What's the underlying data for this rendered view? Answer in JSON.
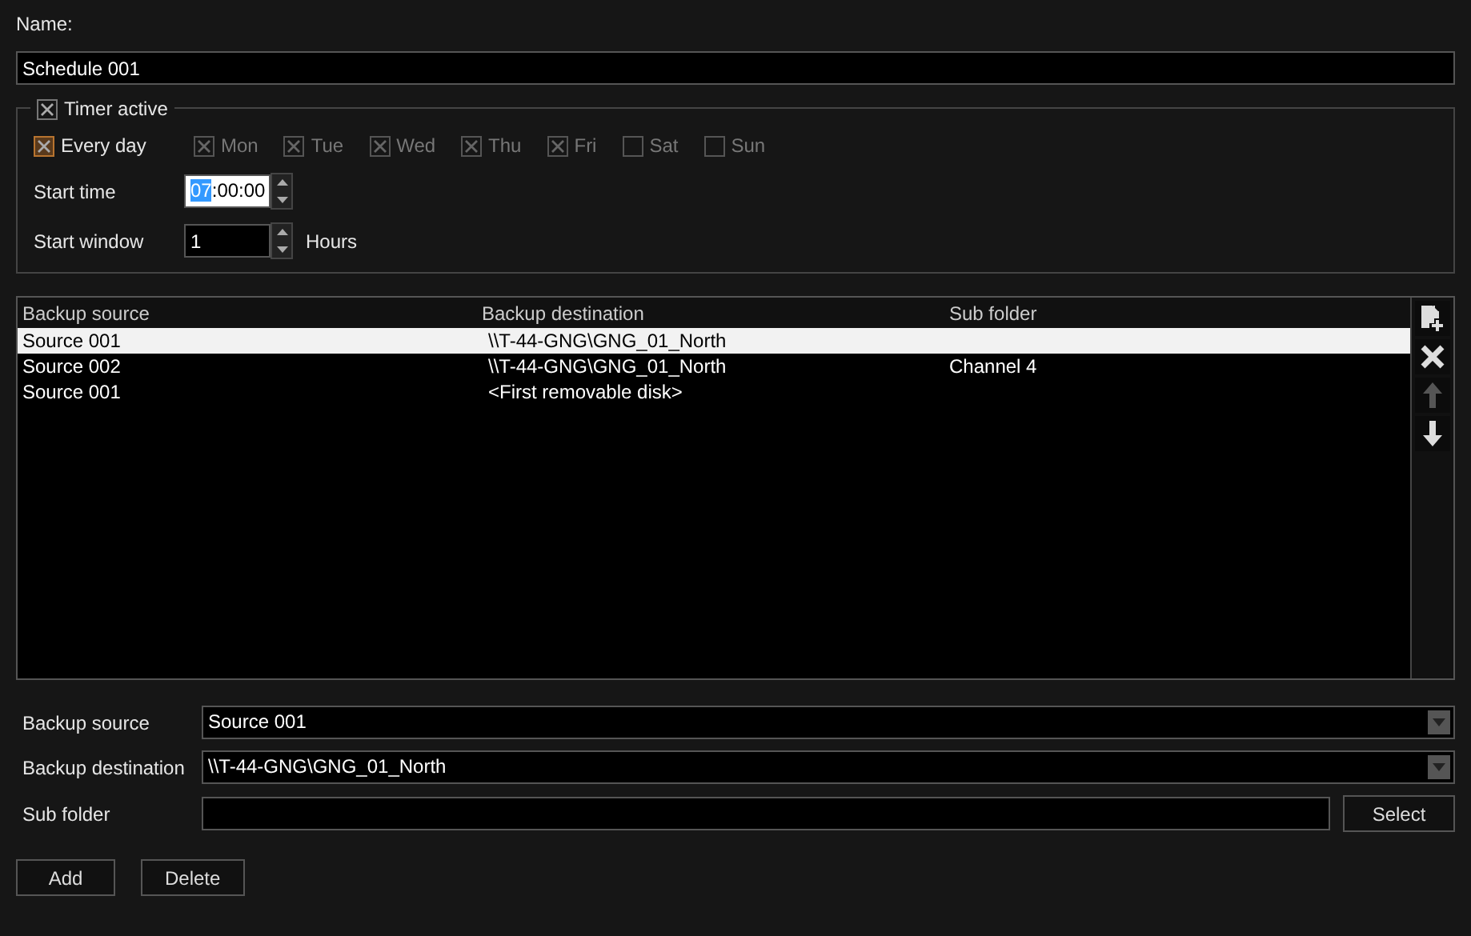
{
  "name_label": "Name:",
  "name_value": "Schedule 001",
  "timer": {
    "label": "Timer active",
    "checked": true
  },
  "every_day": {
    "label": "Every day",
    "checked": true
  },
  "days": [
    {
      "label": "Mon",
      "checked": true,
      "disabled": true
    },
    {
      "label": "Tue",
      "checked": true,
      "disabled": true
    },
    {
      "label": "Wed",
      "checked": true,
      "disabled": true
    },
    {
      "label": "Thu",
      "checked": true,
      "disabled": true
    },
    {
      "label": "Fri",
      "checked": true,
      "disabled": true
    },
    {
      "label": "Sat",
      "checked": false,
      "disabled": true
    },
    {
      "label": "Sun",
      "checked": false,
      "disabled": true
    }
  ],
  "start_time": {
    "label": "Start time",
    "selected_part": "07",
    "value_rest": ":00:00"
  },
  "start_window": {
    "label": "Start window",
    "value": "1",
    "unit": "Hours"
  },
  "table": {
    "columns": [
      "Backup source",
      "Backup destination",
      "Sub folder"
    ],
    "rows": [
      {
        "cells": [
          "Source 001",
          "\\\\T-44-GNG\\GNG_01_North",
          ""
        ],
        "selected": true
      },
      {
        "cells": [
          "Source 002",
          "\\\\T-44-GNG\\GNG_01_North",
          "Channel 4"
        ],
        "selected": false
      },
      {
        "cells": [
          "Source 001",
          "<First removable disk>",
          ""
        ],
        "selected": false
      }
    ]
  },
  "toolbar": [
    {
      "kind": "add",
      "disabled": false
    },
    {
      "kind": "delete",
      "disabled": false
    },
    {
      "kind": "up",
      "disabled": true
    },
    {
      "kind": "down",
      "disabled": false
    }
  ],
  "form": {
    "source_label": "Backup source",
    "source_value": "Source 001",
    "destination_label": "Backup destination",
    "destination_value": "\\\\T-44-GNG\\GNG_01_North",
    "subfolder_label": "Sub folder",
    "select_button": "Select"
  },
  "buttons": [
    "Add",
    "Delete"
  ]
}
